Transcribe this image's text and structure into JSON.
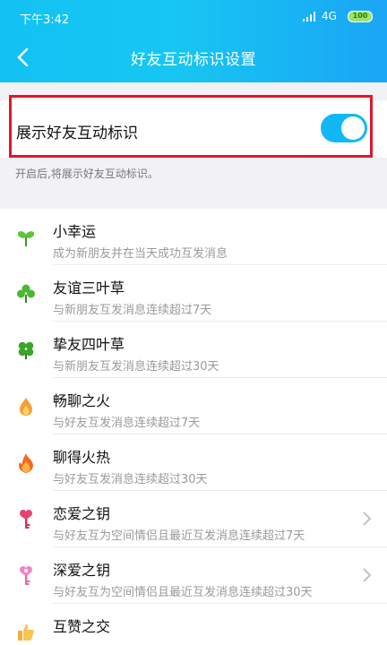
{
  "status_bar": {
    "time": "下午3:42",
    "network": "4G",
    "battery": "100"
  },
  "header": {
    "title": "好友互动标识设置"
  },
  "toggle": {
    "label": "展示好友互动标识",
    "enabled": true
  },
  "hint": "开启后,将展示好友互动标识。",
  "items": [
    {
      "name": "小幸运",
      "desc": "成为新朋友并在当天成功互发消息",
      "icon": "sprout-icon"
    },
    {
      "name": "友谊三叶草",
      "desc": "与新朋友互发消息连续超过7天",
      "icon": "three-leaf-clover-icon"
    },
    {
      "name": "挚友四叶草",
      "desc": "与新朋友互发消息连续超过30天",
      "icon": "four-leaf-clover-icon"
    },
    {
      "name": "畅聊之火",
      "desc": "与好友互发消息连续超过7天",
      "icon": "small-flame-icon"
    },
    {
      "name": "聊得火热",
      "desc": "与好友互发消息连续超过30天",
      "icon": "big-flame-icon"
    },
    {
      "name": "恋爱之钥",
      "desc": "与好友互为空间情侣且最近互发消息连续超过7天",
      "icon": "heart-key-icon"
    },
    {
      "name": "深爱之钥",
      "desc": "与好友互为空间情侣且最近互发消息连续超过30天",
      "icon": "pink-heart-key-icon"
    },
    {
      "name": "互赞之交",
      "desc": "",
      "icon": "thumbs-up-icon"
    }
  ],
  "colors": {
    "header_start": "#12c2f3",
    "header_end": "#1aa5f5",
    "toggle_on": "#12b7f5",
    "highlight": "#e3162a"
  }
}
